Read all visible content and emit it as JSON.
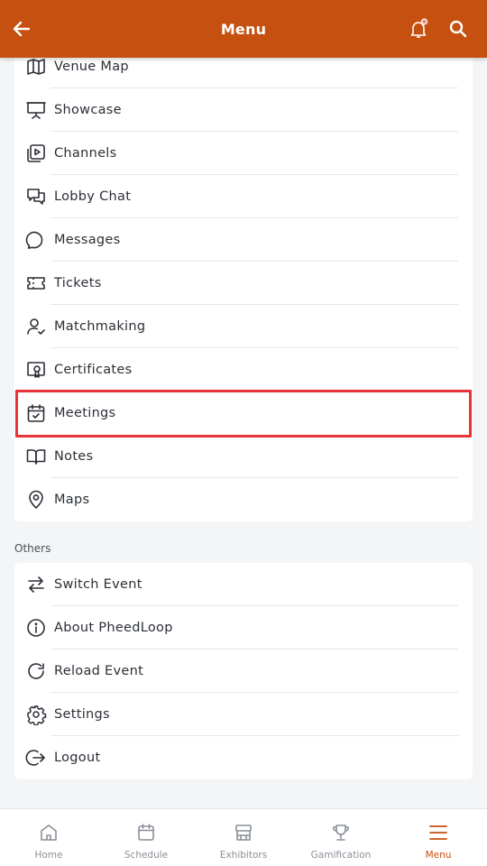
{
  "header": {
    "title": "Menu",
    "back_icon": "arrow-left-icon",
    "bell_icon": "bell-icon",
    "search_icon": "search-icon",
    "accent": "#c5500f",
    "notification_dot": "#f28b82"
  },
  "main_menu": {
    "items": [
      {
        "label": "Venue Map",
        "icon": "map-icon"
      },
      {
        "label": "Showcase",
        "icon": "presentation-icon"
      },
      {
        "label": "Channels",
        "icon": "video-library-icon"
      },
      {
        "label": "Lobby Chat",
        "icon": "chat-bubbles-icon"
      },
      {
        "label": "Messages",
        "icon": "message-circle-icon"
      },
      {
        "label": "Tickets",
        "icon": "ticket-icon"
      },
      {
        "label": "Matchmaking",
        "icon": "user-check-icon"
      },
      {
        "label": "Certificates",
        "icon": "certificate-icon"
      },
      {
        "label": "Meetings",
        "icon": "calendar-check-icon"
      },
      {
        "label": "Notes",
        "icon": "book-open-icon"
      },
      {
        "label": "Maps",
        "icon": "map-pin-icon"
      }
    ]
  },
  "others": {
    "title": "Others",
    "items": [
      {
        "label": "Switch Event",
        "icon": "switch-arrows-icon"
      },
      {
        "label": "About PheedLoop",
        "icon": "info-icon"
      },
      {
        "label": "Reload Event",
        "icon": "reload-icon"
      },
      {
        "label": "Settings",
        "icon": "gear-icon"
      },
      {
        "label": "Logout",
        "icon": "logout-icon"
      }
    ]
  },
  "tabbar": {
    "tabs": [
      {
        "label": "Home",
        "icon": "home-icon"
      },
      {
        "label": "Schedule",
        "icon": "calendar-icon"
      },
      {
        "label": "Exhibitors",
        "icon": "booth-icon"
      },
      {
        "label": "Gamification",
        "icon": "trophy-icon"
      },
      {
        "label": "Menu",
        "icon": "hamburger-menu-icon",
        "active": true
      }
    ]
  },
  "highlight_color": "#e8333a"
}
